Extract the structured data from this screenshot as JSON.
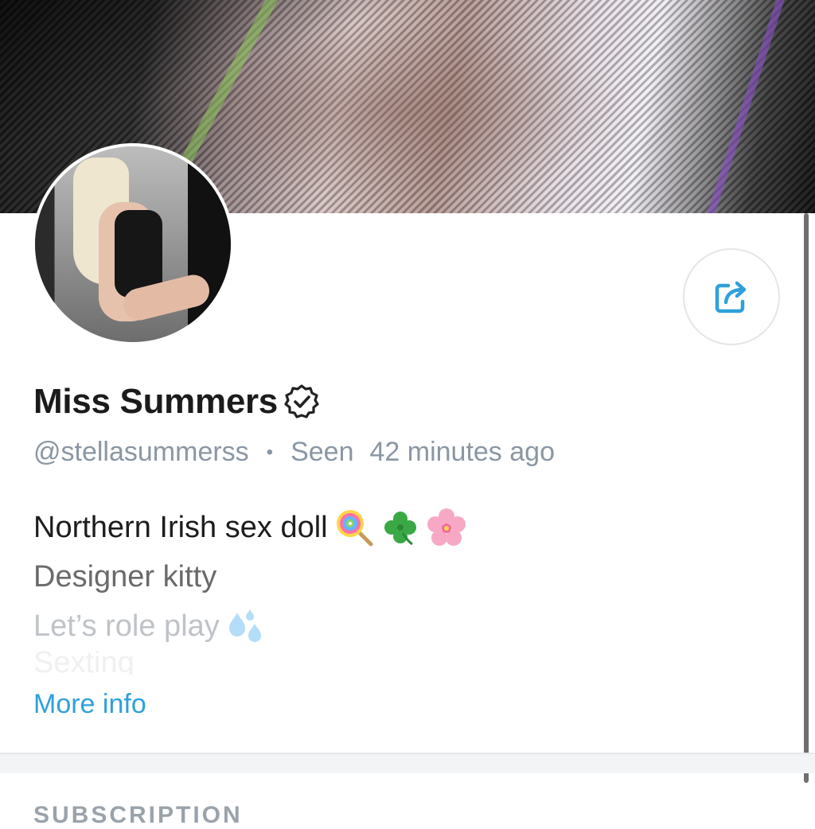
{
  "profile": {
    "display_name": "Miss Summers",
    "username": "@stellasummerss",
    "separator": "•",
    "seen_label": "Seen",
    "seen_time": "42 minutes ago",
    "bio_lines": [
      "Northern Irish sex doll",
      "Designer kitty",
      "Let’s role play",
      "Sexting"
    ],
    "more_info": "More info"
  },
  "icons": {
    "share": "share-icon",
    "verified": "verified-badge-icon",
    "bio_emojis": [
      "lollipop-emoji",
      "four-leaf-clover-emoji",
      "cherry-blossom-emoji",
      "sweat-droplets-emoji"
    ]
  },
  "sections": {
    "subscription_title": "SUBSCRIPTION"
  },
  "colors": {
    "accent": "#2ea0dc",
    "muted_text": "#8a96a3"
  }
}
